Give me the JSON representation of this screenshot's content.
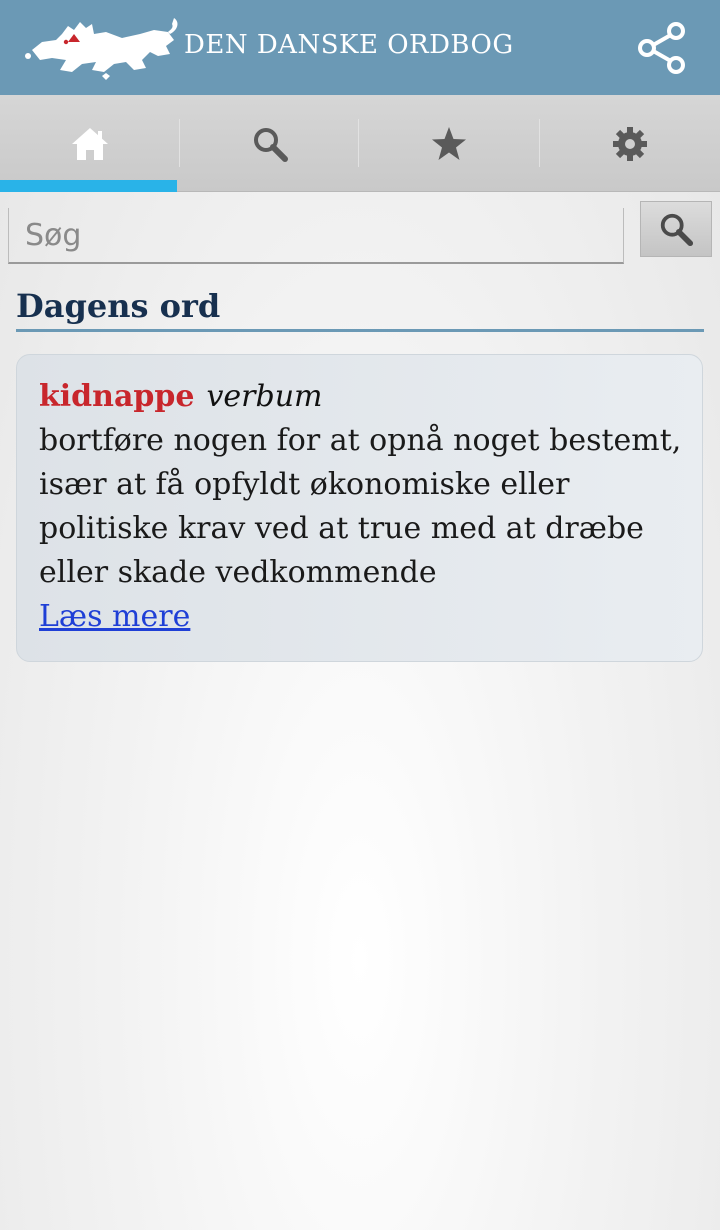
{
  "header": {
    "title": "DEN DANSKE ORDBOG",
    "logo_icon": "lion-logo-icon",
    "share_icon": "share-icon",
    "bg_color": "#6b99b5"
  },
  "tabs": [
    {
      "name": "home",
      "icon": "home-icon",
      "selected": true
    },
    {
      "name": "search",
      "icon": "search-icon",
      "selected": false
    },
    {
      "name": "favorites",
      "icon": "star-icon",
      "selected": false
    },
    {
      "name": "settings",
      "icon": "gear-icon",
      "selected": false
    }
  ],
  "tab_indicator_color": "#29b3e8",
  "search": {
    "placeholder": "Søg",
    "value": "",
    "button_icon": "search-icon"
  },
  "word_of_day": {
    "section_title": "Dagens ord",
    "word": "kidnappe",
    "word_class": "verbum",
    "definition": "bortføre nogen for at opnå noget bestemt, især at få opfyldt økonomiske eller politiske krav ved at true med at dræbe eller skade vedkommende",
    "read_more": "Læs mere",
    "word_color": "#c8262c",
    "link_color": "#1f3fd6"
  }
}
